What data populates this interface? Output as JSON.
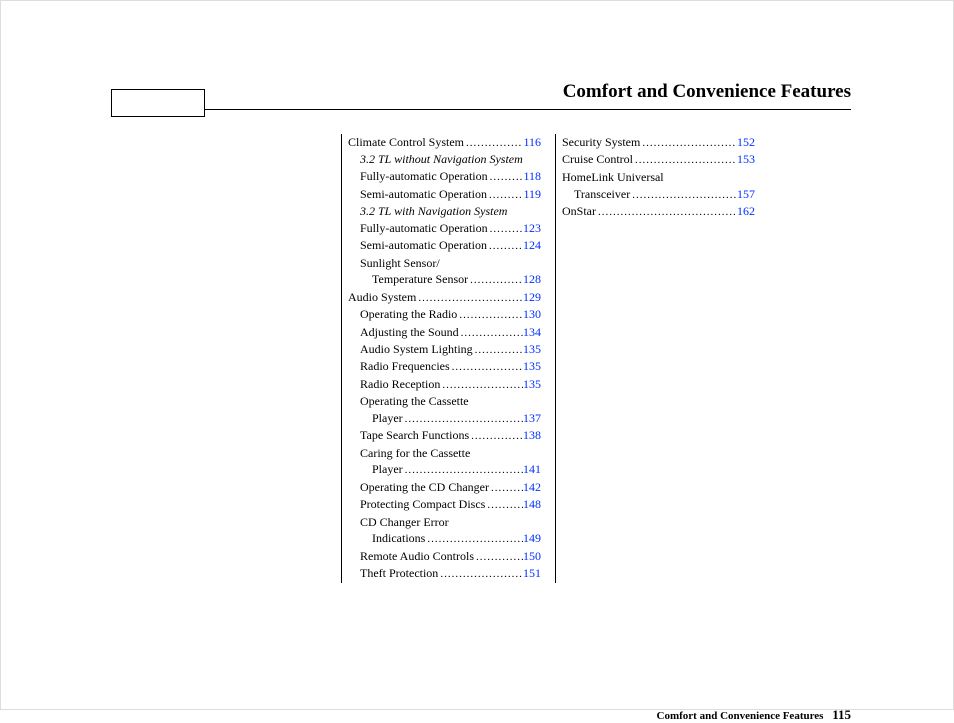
{
  "title": "Comfort and Convenience Features",
  "footer_label": "Comfort and Convenience Features",
  "footer_page": "115",
  "col1": [
    {
      "label": "Climate Control System",
      "page": "116",
      "indent": 0
    },
    {
      "label": "3.2 TL without Navigation System",
      "indent": 1,
      "style": "italic",
      "nodots": true
    },
    {
      "label": "Fully-automatic Operation",
      "page": "118",
      "indent": 1
    },
    {
      "label": "Semi-automatic Operation",
      "page": "119",
      "indent": 1
    },
    {
      "label": "3.2 TL with Navigation System",
      "indent": 1,
      "style": "italic",
      "nodots": true
    },
    {
      "label": "Fully-automatic Operation",
      "page": "123",
      "indent": 1
    },
    {
      "label": "Semi-automatic Operation",
      "page": "124",
      "indent": 1
    },
    {
      "label": "Sunlight Sensor/",
      "indent": 1,
      "nodots": true
    },
    {
      "label": "Temperature Sensor",
      "page": "128",
      "indent": 2
    },
    {
      "label": "Audio System",
      "page": "129",
      "indent": 0
    },
    {
      "label": "Operating the Radio",
      "page": "130",
      "indent": 1
    },
    {
      "label": "Adjusting the Sound",
      "page": "134",
      "indent": 1
    },
    {
      "label": "Audio System Lighting",
      "page": "135",
      "indent": 1
    },
    {
      "label": "Radio Frequencies",
      "page": "135",
      "indent": 1
    },
    {
      "label": "Radio Reception",
      "page": "135",
      "indent": 1
    },
    {
      "label": "Operating the Cassette",
      "indent": 1,
      "nodots": true
    },
    {
      "label": "Player",
      "page": "137",
      "indent": 2
    },
    {
      "label": "Tape Search Functions",
      "page": "138",
      "indent": 1
    },
    {
      "label": "Caring for the Cassette",
      "indent": 1,
      "nodots": true
    },
    {
      "label": "Player",
      "page": "141",
      "indent": 2
    },
    {
      "label": "Operating the CD Changer",
      "page": "142",
      "indent": 1
    },
    {
      "label": "Protecting Compact Discs",
      "page": "148",
      "indent": 1
    },
    {
      "label": "CD Changer Error",
      "indent": 1,
      "nodots": true
    },
    {
      "label": "Indications",
      "page": "149",
      "indent": 2
    },
    {
      "label": "Remote Audio Controls",
      "page": "150",
      "indent": 1
    },
    {
      "label": "Theft Protection",
      "page": "151",
      "indent": 1
    }
  ],
  "col2": [
    {
      "label": "Security System",
      "page": "152",
      "indent": 0
    },
    {
      "label": "Cruise Control",
      "page": "153",
      "indent": 0
    },
    {
      "label": "HomeLink Universal",
      "indent": 0,
      "nodots": true
    },
    {
      "label": "Transceiver",
      "page": "157",
      "indent": 1
    },
    {
      "label": "OnStar",
      "page": "162",
      "indent": 0
    }
  ]
}
